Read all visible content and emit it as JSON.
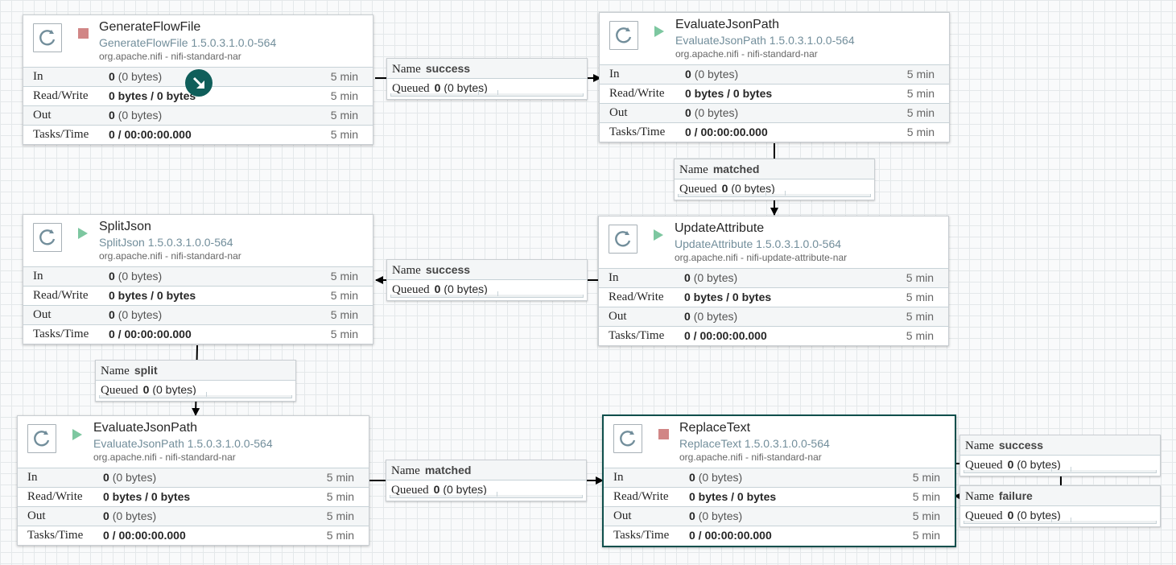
{
  "labels": {
    "in": "In",
    "read_write": "Read/Write",
    "out": "Out",
    "tasks_time": "Tasks/Time",
    "conn_name": "Name",
    "conn_queued": "Queued"
  },
  "processors": [
    {
      "name": "GenerateFlowFile",
      "type": "GenerateFlowFile 1.5.0.3.1.0.0-564",
      "bundle": "org.apache.nifi - nifi-standard-nar",
      "state": "stopped",
      "in_count": "0",
      "in_size": "(0 bytes)",
      "rw": "0 bytes / 0 bytes",
      "out_count": "0",
      "out_size": "(0 bytes)",
      "tasks": "0 / 00:00:00.000",
      "window": "5 min"
    },
    {
      "name": "EvaluateJsonPath",
      "type": "EvaluateJsonPath 1.5.0.3.1.0.0-564",
      "bundle": "org.apache.nifi - nifi-standard-nar",
      "state": "running",
      "in_count": "0",
      "in_size": "(0 bytes)",
      "rw": "0 bytes / 0 bytes",
      "out_count": "0",
      "out_size": "(0 bytes)",
      "tasks": "0 / 00:00:00.000",
      "window": "5 min"
    },
    {
      "name": "SplitJson",
      "type": "SplitJson 1.5.0.3.1.0.0-564",
      "bundle": "org.apache.nifi - nifi-standard-nar",
      "state": "running",
      "in_count": "0",
      "in_size": "(0 bytes)",
      "rw": "0 bytes / 0 bytes",
      "out_count": "0",
      "out_size": "(0 bytes)",
      "tasks": "0 / 00:00:00.000",
      "window": "5 min"
    },
    {
      "name": "UpdateAttribute",
      "type": "UpdateAttribute 1.5.0.3.1.0.0-564",
      "bundle": "org.apache.nifi - nifi-update-attribute-nar",
      "state": "running",
      "in_count": "0",
      "in_size": "(0 bytes)",
      "rw": "0 bytes / 0 bytes",
      "out_count": "0",
      "out_size": "(0 bytes)",
      "tasks": "0 / 00:00:00.000",
      "window": "5 min"
    },
    {
      "name": "EvaluateJsonPath",
      "type": "EvaluateJsonPath 1.5.0.3.1.0.0-564",
      "bundle": "org.apache.nifi - nifi-standard-nar",
      "state": "running",
      "in_count": "0",
      "in_size": "(0 bytes)",
      "rw": "0 bytes / 0 bytes",
      "out_count": "0",
      "out_size": "(0 bytes)",
      "tasks": "0 / 00:00:00.000",
      "window": "5 min"
    },
    {
      "name": "ReplaceText",
      "type": "ReplaceText 1.5.0.3.1.0.0-564",
      "bundle": "org.apache.nifi - nifi-standard-nar",
      "state": "stopped",
      "in_count": "0",
      "in_size": "(0 bytes)",
      "rw": "0 bytes / 0 bytes",
      "out_count": "0",
      "out_size": "(0 bytes)",
      "tasks": "0 / 00:00:00.000",
      "window": "5 min"
    }
  ],
  "connections": [
    {
      "relationship": "success",
      "queued_count": "0",
      "queued_size": "(0 bytes)"
    },
    {
      "relationship": "matched",
      "queued_count": "0",
      "queued_size": "(0 bytes)"
    },
    {
      "relationship": "success",
      "queued_count": "0",
      "queued_size": "(0 bytes)"
    },
    {
      "relationship": "split",
      "queued_count": "0",
      "queued_size": "(0 bytes)"
    },
    {
      "relationship": "matched",
      "queued_count": "0",
      "queued_size": "(0 bytes)"
    },
    {
      "relationship": "success",
      "queued_count": "0",
      "queued_size": "(0 bytes)"
    },
    {
      "relationship": "failure",
      "queued_count": "0",
      "queued_size": "(0 bytes)"
    }
  ],
  "colors": {
    "stopped": "#d18686",
    "running": "#7dc7a0",
    "bulletin": "#0f5e5a",
    "selected_border": "#0f4f4c"
  }
}
